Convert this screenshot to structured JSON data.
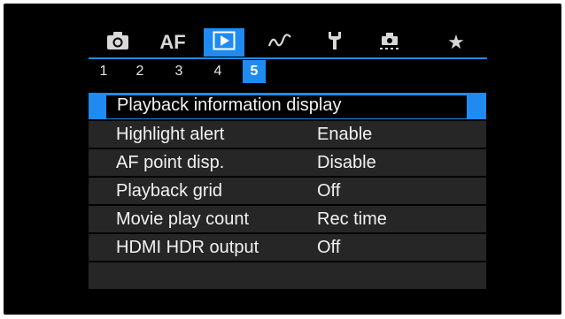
{
  "tabs": [
    {
      "icon": "camera-icon",
      "label": ""
    },
    {
      "icon": "af-icon",
      "label": "AF"
    },
    {
      "icon": "playback-icon",
      "label": ""
    },
    {
      "icon": "wireless-icon",
      "label": ""
    },
    {
      "icon": "wrench-icon",
      "label": ""
    },
    {
      "icon": "custom-functions-icon",
      "label": ""
    },
    {
      "icon": "my-menu-star-icon",
      "label": "★"
    }
  ],
  "active_tab": 2,
  "pages": [
    "1",
    "2",
    "3",
    "4",
    "5"
  ],
  "active_page": "5",
  "menu": {
    "items": [
      {
        "label": "Playback information display",
        "value": ""
      },
      {
        "label": "Highlight alert",
        "value": "Enable"
      },
      {
        "label": "AF point disp.",
        "value": "Disable"
      },
      {
        "label": "Playback grid",
        "value": "Off"
      },
      {
        "label": "Movie play count",
        "value": "Rec time"
      },
      {
        "label": "HDMI HDR output",
        "value": "Off"
      }
    ]
  },
  "colors": {
    "accent": "#1f8bf0",
    "background": "#000000",
    "row": "#262626",
    "text": "#f2f2f2"
  }
}
